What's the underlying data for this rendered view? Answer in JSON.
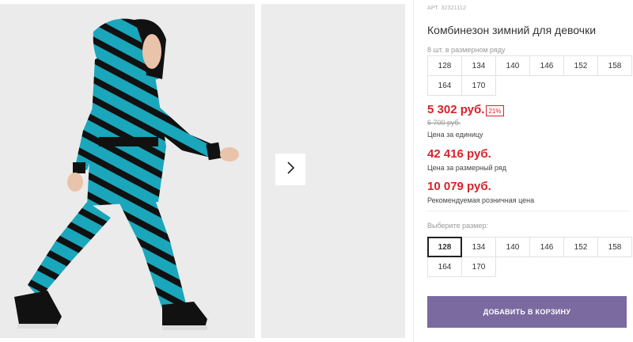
{
  "product": {
    "sku": "АРТ. 32321112",
    "title": "Комбинезон зимний для девочки",
    "row_info": "8 шт. в размерном ряду",
    "row_sizes": [
      "128",
      "134",
      "140",
      "146",
      "152",
      "158",
      "164",
      "170"
    ]
  },
  "pricing": {
    "unit_price": "5 302 руб.",
    "discount_badge": "21%",
    "old_price": "6 700 руб.",
    "unit_caption": "Цена за единицу",
    "row_price": "42 416 руб.",
    "row_caption": "Цена за размерный ряд",
    "retail_price": "10 079 руб.",
    "retail_caption": "Рекомендуемая розничная цена"
  },
  "size_select": {
    "label": "Выберите размер:",
    "selected": "128",
    "options": [
      "128",
      "134",
      "140",
      "146",
      "152",
      "158",
      "164",
      "170"
    ]
  },
  "cart": {
    "button_label": "ДОБАВИТЬ В КОРЗИНУ"
  },
  "icons": {
    "next": "chevron-right-icon"
  },
  "colors": {
    "price": "#d6232a",
    "button": "#7b6aa0"
  }
}
